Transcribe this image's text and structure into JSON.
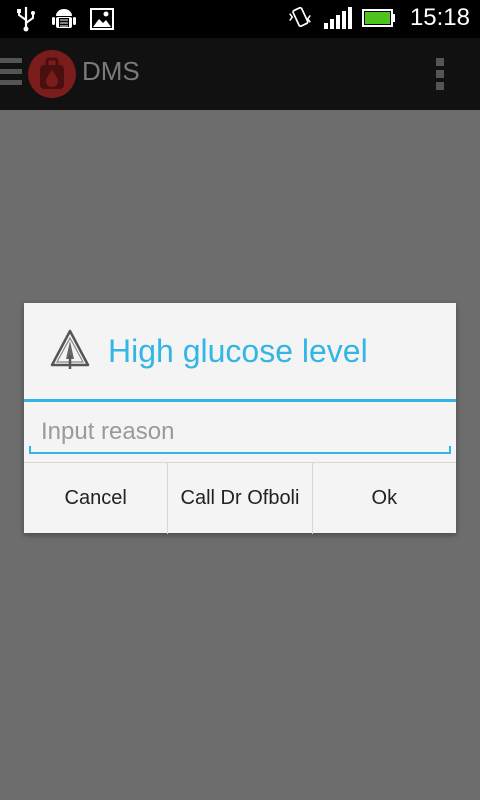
{
  "status_bar": {
    "time": "15:18",
    "icons": [
      "usb-icon",
      "android-debug-icon",
      "image-icon",
      "vibrate-icon",
      "signal-icon",
      "battery-icon"
    ]
  },
  "action_bar": {
    "title": "DMS"
  },
  "dialog": {
    "title": "High glucose level",
    "input_placeholder": "Input reason",
    "buttons": {
      "cancel": "Cancel",
      "call": "Call Dr Ofboli",
      "ok": "Ok"
    }
  },
  "colors": {
    "accent": "#33b5e5",
    "overlay": "#6d6d6d",
    "dialog_bg": "#f4f4f4"
  }
}
